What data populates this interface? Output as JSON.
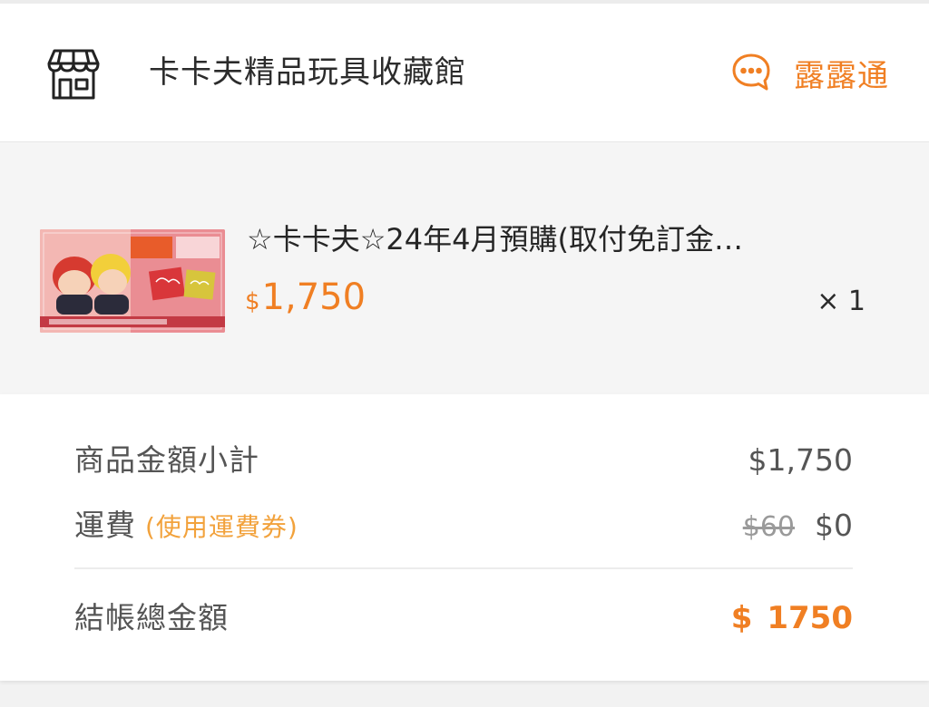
{
  "shop": {
    "name": "卡卡夫精品玩具收藏館",
    "chat_label": "露露通"
  },
  "item": {
    "title": "☆卡卡夫☆24年4月預購(取付免訂金…",
    "price_currency": "$",
    "price": "1,750",
    "quantity": "× 1"
  },
  "summary": {
    "subtotal_label": "商品金額小計",
    "subtotal_value": "$1,750",
    "shipping_label": "運費",
    "shipping_coupon_note": "(使用運費券)",
    "shipping_original": "$60",
    "shipping_value": "$0",
    "total_label": "結帳總金額",
    "total_currency": "$",
    "total_value": "1750"
  },
  "colors": {
    "accent": "#f07f23",
    "coupon_note": "#f2a23c",
    "text_dark": "#2b2b2b",
    "text_muted": "#555555"
  },
  "icons": {
    "shop": "store-icon",
    "chat": "chat-bubble-icon"
  }
}
